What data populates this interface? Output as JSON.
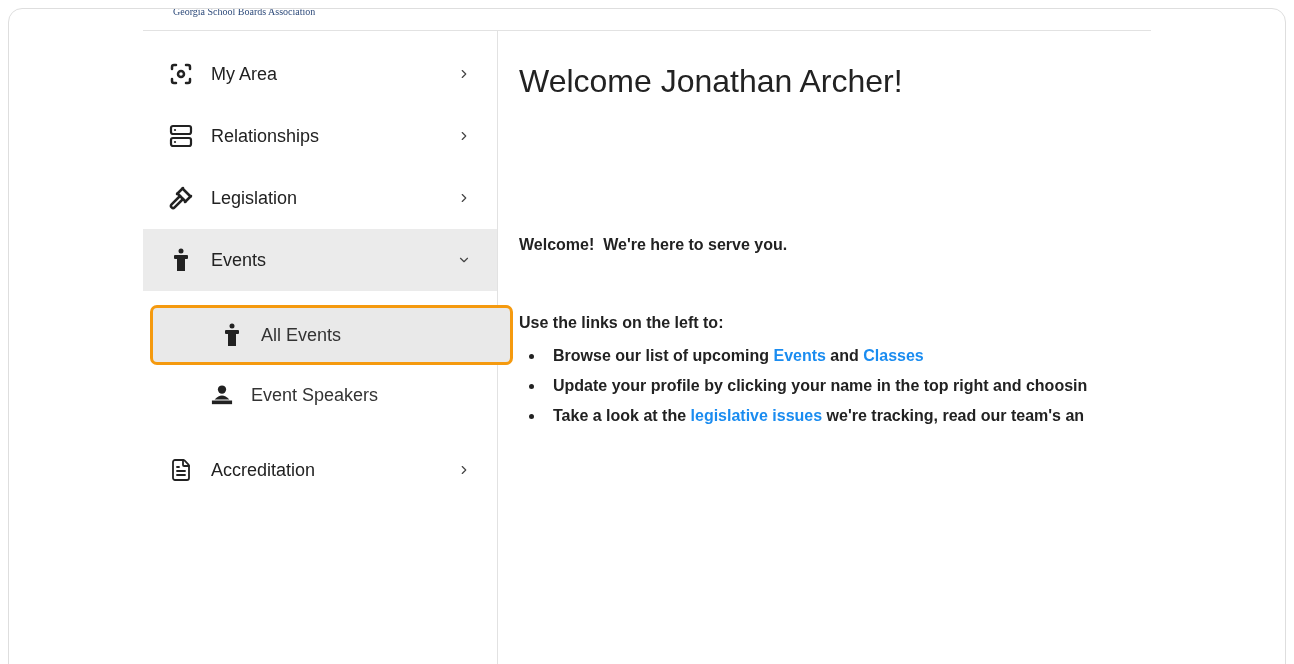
{
  "header": {
    "logo_text": "Georgia School Boards Association"
  },
  "sidebar": {
    "items": [
      {
        "label": "My Area",
        "expanded": false,
        "selected": false
      },
      {
        "label": "Relationships",
        "expanded": false,
        "selected": false
      },
      {
        "label": "Legislation",
        "expanded": false,
        "selected": false
      },
      {
        "label": "Events",
        "expanded": true,
        "selected": true,
        "children": [
          {
            "label": "All Events",
            "selected": true,
            "highlighted": true
          },
          {
            "label": "Event Speakers",
            "selected": false,
            "highlighted": false
          }
        ]
      },
      {
        "label": "Accreditation",
        "expanded": false,
        "selected": false
      }
    ]
  },
  "main": {
    "heading": "Welcome Jonathan Archer!",
    "intro": "Welcome!  We're here to serve you.",
    "list_title": "Use the links on the left to:",
    "bullets": [
      [
        {
          "text": "Browse our list of upcoming ",
          "link": false
        },
        {
          "text": "Events",
          "link": true
        },
        {
          "text": " and ",
          "link": false
        },
        {
          "text": "Classes",
          "link": true
        }
      ],
      [
        {
          "text": "Update your profile by clicking your name in the top right and choosin",
          "link": false
        }
      ],
      [
        {
          "text": "Take a look at the ",
          "link": false
        },
        {
          "text": "legislative issues",
          "link": true
        },
        {
          "text": " we're tracking, read our team's an",
          "link": false
        }
      ]
    ]
  }
}
